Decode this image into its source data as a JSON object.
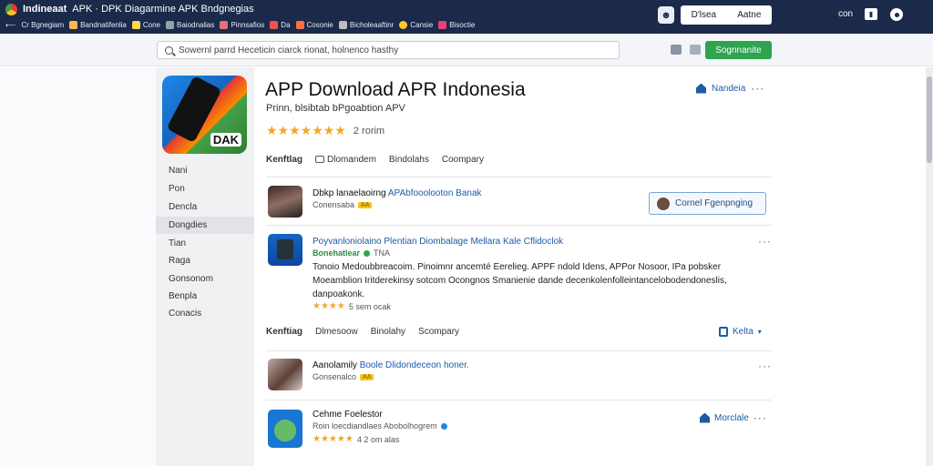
{
  "browser": {
    "site": "Indineaat",
    "title": "APK · DPK Diagarmine APK Bndgnegias",
    "bookmarks": [
      "Cr Bgnegiam",
      "Bandnatifenlia",
      "Cone",
      "Baiodnalias",
      "Pinnsafios",
      "Da",
      "Cosonie",
      "Bicholeaaftinr",
      "Cansie",
      "Bisoctie"
    ],
    "account_left": "D'lsea",
    "account_right": "Aatne",
    "right_label": "con",
    "right_icon": "user-icon"
  },
  "search": {
    "value": "Sowernl parrd Heceticin ciarck rionat, holnenco hasthy",
    "signup_label": "Sognnanite"
  },
  "sidebar": {
    "items": [
      "Nani",
      "Pon",
      "Dencla",
      "Dongdies",
      "Tian",
      "Raga",
      "Gonsonom",
      "Benpla",
      "Conacis"
    ],
    "active_index": 3
  },
  "app": {
    "icon_text": "DAK",
    "title": "APP Download APR Indonesia",
    "subtitle": "Prinn, blsibtab bPgoabtion APV",
    "rating_stars": "★★★★★★★",
    "rating_text": "2 rorim",
    "follow_label": "Nandeia"
  },
  "tabs_top": {
    "items": [
      "Kenftlag",
      "Dlomandem",
      "Bindolahs",
      "Coompary"
    ]
  },
  "rows": [
    {
      "title_a": "Dbkp lanaelaoirng",
      "title_b": "APAbfooolooton Banak",
      "meta": "Conensaba",
      "tag": "AA",
      "button": "Cornel Fgenpnging"
    },
    {
      "title": "Poyvanloniolaino Plentian Diombalage Mellara Kale Cflidoclok",
      "meta": "Bonehatlear",
      "meta_extra": "TNA",
      "desc": "Tonoio Medoubbreacoim. Pinoimnr ancemté Eerelieg. APPF ndold Idens, APPor Nosoor, IPa pobsker Moeamblion Iritderekinsy sotcom Ocongnos Smanienie dande decenkolenfolleintancelobodendoneslis, danpoakonk.",
      "stars": "★★★★",
      "stars_text": "5 sem ocak"
    },
    {
      "title_a": "Aanolamily",
      "title_b": "Boole Dlidondeceon honer.",
      "meta": "Gonsenalco",
      "tag": "AA"
    },
    {
      "title": "Cehme Foelestor",
      "meta": "Roin loecdiandlaes Abobolhogrem",
      "stars": "★★★★★",
      "stars_text": "4 2 om alas",
      "more_label": "Morclale"
    }
  ],
  "tabs_mid": {
    "items": [
      "Kenftiag",
      "Dlmesoow",
      "Binolahy",
      "Scompary"
    ],
    "more_label": "Kelta"
  },
  "colors": {
    "chrome": "#1b2a4a",
    "accent": "#1e5aa8",
    "signup": "#2ea44f",
    "stars": "#f4a623"
  }
}
